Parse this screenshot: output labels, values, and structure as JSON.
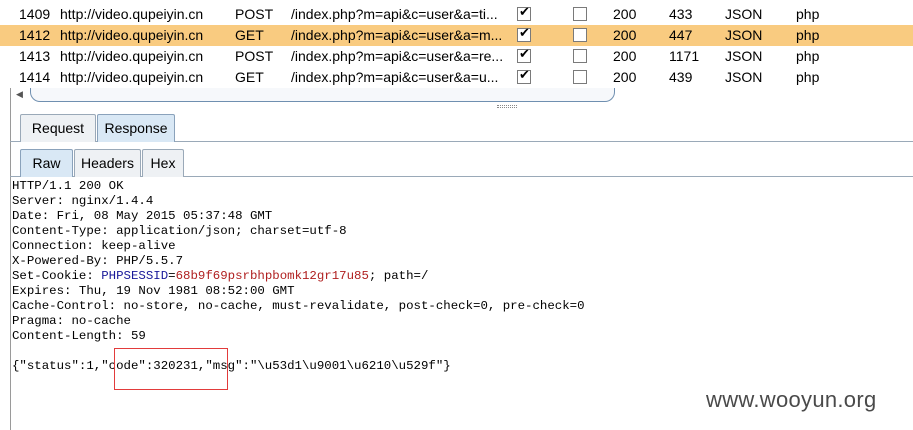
{
  "history": {
    "rows": [
      {
        "num": "1409",
        "host": "http://video.qupeiyin.cn",
        "method": "POST",
        "url": "/index.php?m=api&c=user&a=ti...",
        "params": true,
        "edited": false,
        "status": "200",
        "length": "433",
        "mime": "JSON",
        "ext": "php",
        "selected": false
      },
      {
        "num": "1412",
        "host": "http://video.qupeiyin.cn",
        "method": "GET",
        "url": "/index.php?m=api&c=user&a=m...",
        "params": true,
        "edited": false,
        "status": "200",
        "length": "447",
        "mime": "JSON",
        "ext": "php",
        "selected": true
      },
      {
        "num": "1413",
        "host": "http://video.qupeiyin.cn",
        "method": "POST",
        "url": "/index.php?m=api&c=user&a=re...",
        "params": true,
        "edited": false,
        "status": "200",
        "length": "1171",
        "mime": "JSON",
        "ext": "php",
        "selected": false
      },
      {
        "num": "1414",
        "host": "http://video.qupeiyin.cn",
        "method": "GET",
        "url": "/index.php?m=api&c=user&a=u...",
        "params": true,
        "edited": false,
        "status": "200",
        "length": "439",
        "mime": "JSON",
        "ext": "php",
        "selected": false
      }
    ],
    "selected_row_color": "#f9cb80",
    "scroll_left_icon": "triangle-left"
  },
  "message_tabs": {
    "request": "Request",
    "response": "Response",
    "active": "response"
  },
  "view_tabs": {
    "raw": "Raw",
    "headers": "Headers",
    "hex": "Hex",
    "active": "raw"
  },
  "response": {
    "status_line": "HTTP/1.1 200 OK",
    "server": "Server: nginx/1.4.4",
    "date": "Date: Fri, 08 May 2015 05:37:48 GMT",
    "content_type": "Content-Type: application/json; charset=utf-8",
    "connection": "Connection: keep-alive",
    "powered_by": "X-Powered-By: PHP/5.5.7",
    "set_cookie_prefix": "Set-Cookie: ",
    "cookie_name": "PHPSESSID",
    "cookie_eq": "=",
    "cookie_value": "68b9f69psrbhpbomk12gr17u85",
    "cookie_suffix": "; path=/",
    "expires": "Expires: Thu, 19 Nov 1981 08:52:00 GMT",
    "cache_control": "Cache-Control: no-store, no-cache, must-revalidate, post-check=0, pre-check=0",
    "pragma": "Pragma: no-cache",
    "content_length": "Content-Length: 59",
    "json_body": "{\"status\":1,\"code\":320231,\"msg\":\"\\u53d1\\u9001\\u6210\\u529f\"}",
    "highlight_color": "#e23b3b"
  },
  "watermark": "www.wooyun.org"
}
